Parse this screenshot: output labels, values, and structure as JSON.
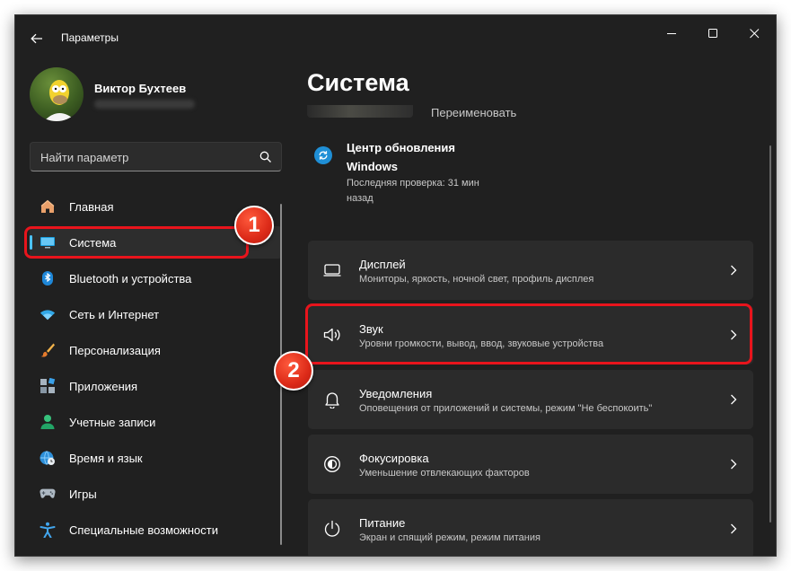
{
  "window": {
    "title": "Параметры"
  },
  "user": {
    "name": "Виктор Бухтеев"
  },
  "search": {
    "placeholder": "Найти параметр"
  },
  "sidebar": {
    "items": [
      {
        "label": "Главная",
        "icon": "home-icon"
      },
      {
        "label": "Система",
        "icon": "monitor-icon",
        "selected": true
      },
      {
        "label": "Bluetooth и устройства",
        "icon": "bluetooth-icon"
      },
      {
        "label": "Сеть и Интернет",
        "icon": "wifi-icon"
      },
      {
        "label": "Персонализация",
        "icon": "brush-icon"
      },
      {
        "label": "Приложения",
        "icon": "apps-icon"
      },
      {
        "label": "Учетные записи",
        "icon": "account-icon"
      },
      {
        "label": "Время и язык",
        "icon": "globe-clock-icon"
      },
      {
        "label": "Игры",
        "icon": "gamepad-icon"
      },
      {
        "label": "Специальные возможности",
        "icon": "accessibility-icon"
      }
    ]
  },
  "main": {
    "title": "Система",
    "rename_label": "Переименовать",
    "update": {
      "title": "Центр обновления Windows",
      "subtitle": "Последняя проверка: 31 мин назад"
    },
    "cards": [
      {
        "title": "Дисплей",
        "subtitle": "Мониторы, яркость, ночной свет, профиль дисплея",
        "icon": "display-icon"
      },
      {
        "title": "Звук",
        "subtitle": "Уровни громкости, вывод, ввод, звуковые устройства",
        "icon": "speaker-icon"
      },
      {
        "title": "Уведомления",
        "subtitle": "Оповещения от приложений и системы, режим \"Не беспокоить\"",
        "icon": "bell-icon"
      },
      {
        "title": "Фокусировка",
        "subtitle": "Уменьшение отвлекающих факторов",
        "icon": "focus-icon"
      },
      {
        "title": "Питание",
        "subtitle": "Экран и спящий режим, режим питания",
        "icon": "power-icon"
      }
    ]
  },
  "annotations": {
    "step1": "1",
    "step2": "2",
    "color": "#e8141c"
  },
  "colors": {
    "accent": "#4cc2ff",
    "window_bg": "#202020",
    "card_bg": "#2b2b2b"
  }
}
